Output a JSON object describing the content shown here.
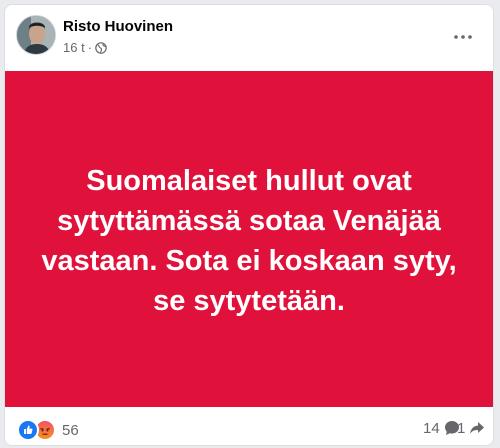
{
  "post": {
    "author": "Risto Huovinen",
    "time": "16 t",
    "separator": "·",
    "audience_icon": "globe-icon",
    "background_color": "#e0123b",
    "text_lines": [
      "Suomalaiset hullut ovat",
      "sytyttämässä sotaa Venäjää",
      "vastaan. Sota ei koskaan syty,",
      "se sytytetään."
    ]
  },
  "footer": {
    "reaction_icons": [
      "like-icon",
      "angry-icon"
    ],
    "reaction_count": "56",
    "comment_count": "14",
    "share_count": "1"
  },
  "colors": {
    "text_secondary": "#65676b",
    "like_blue": "#1877f2"
  }
}
